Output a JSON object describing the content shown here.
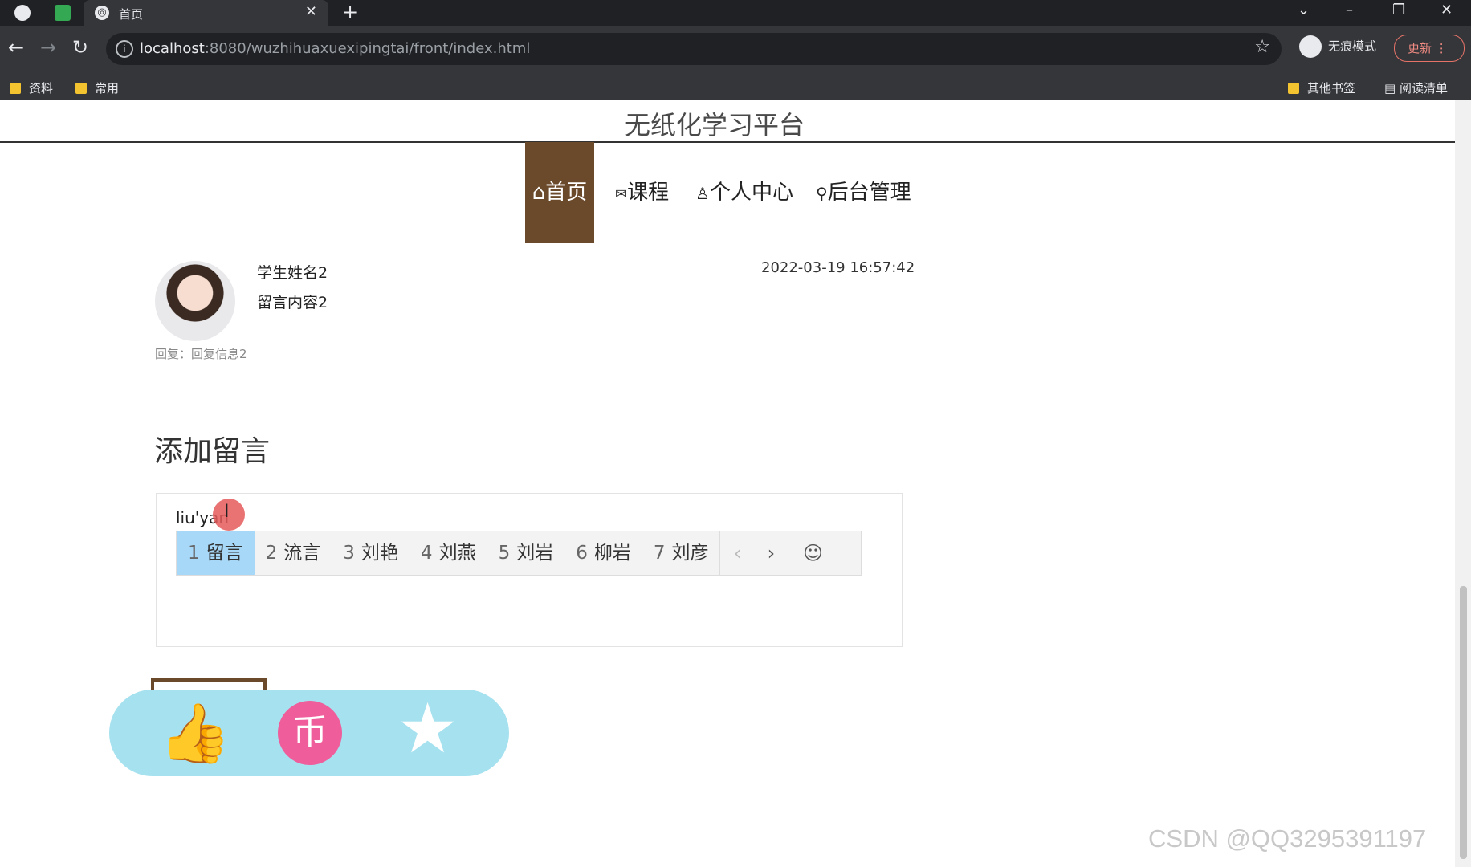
{
  "browser": {
    "tab_title": "首页",
    "url_host": "localhost",
    "url_rest": ":8080/wuzhihuaxuexipingtai/front/index.html",
    "incognito_label": "无痕模式",
    "update_label": "更新",
    "bookmarks": [
      "资料",
      "常用"
    ],
    "bookmarks_right": [
      "其他书签",
      "阅读清单"
    ]
  },
  "site": {
    "title": "无纸化学习平台",
    "nav": [
      {
        "icon": "⌂",
        "label": "首页"
      },
      {
        "icon": "✉",
        "label": "课程"
      },
      {
        "icon": "♙",
        "label": "个人中心"
      },
      {
        "icon": "⚲",
        "label": "后台管理"
      }
    ]
  },
  "message": {
    "name": "学生姓名2",
    "content": "留言内容2",
    "time": "2022-03-19 16:57:42",
    "reply": "回复：回复信息2"
  },
  "add_message": {
    "title": "添加留言",
    "input_value": "liu'yan"
  },
  "ime": {
    "candidates": [
      {
        "num": "1",
        "text": "留言"
      },
      {
        "num": "2",
        "text": "流言"
      },
      {
        "num": "3",
        "text": "刘艳"
      },
      {
        "num": "4",
        "text": "刘燕"
      },
      {
        "num": "5",
        "text": "刘岩"
      },
      {
        "num": "6",
        "text": "柳岩"
      },
      {
        "num": "7",
        "text": "刘彦"
      }
    ]
  },
  "watermark": "CSDN @QQ3295391197",
  "colors": {
    "accent": "#6b4a2b",
    "ime_selected": "#a8d8f8",
    "float_bar": "#a6e1ef",
    "pink": "#ef5d9b"
  }
}
